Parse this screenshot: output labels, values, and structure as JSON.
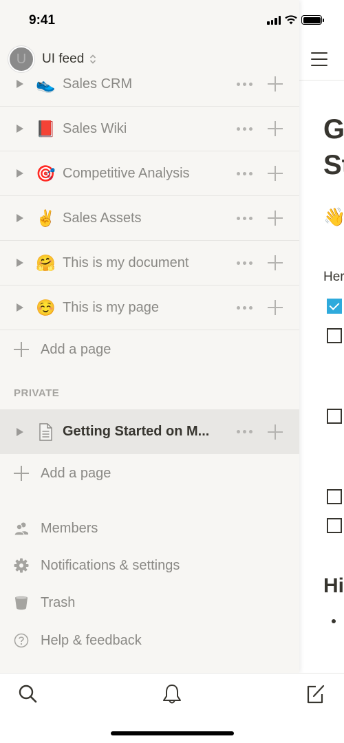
{
  "status_bar": {
    "time": "9:41"
  },
  "workspace": {
    "avatar_letter": "U",
    "name": "UI feed"
  },
  "sidebar": {
    "pages": [
      {
        "emoji": "👟",
        "emoji_name": "sneaker-icon",
        "label": "Sales CRM"
      },
      {
        "emoji": "📕",
        "emoji_name": "red-book-icon",
        "label": "Sales Wiki"
      },
      {
        "emoji": "🎯",
        "emoji_name": "target-icon",
        "label": "Competitive Analysis"
      },
      {
        "emoji": "✌️",
        "emoji_name": "victory-hand-icon",
        "label": "Sales Assets"
      },
      {
        "emoji": "🤗",
        "emoji_name": "hugging-face-icon",
        "label": "This is my document"
      },
      {
        "emoji": "☺️",
        "emoji_name": "smiling-face-icon",
        "label": "This is my page"
      }
    ],
    "add_page_label": "Add a page",
    "private_section": {
      "title": "PRIVATE",
      "pages": [
        {
          "label": "Getting Started on M...",
          "selected": true
        }
      ],
      "add_page_label": "Add a page"
    },
    "menu": [
      {
        "icon": "members-icon",
        "label": "Members"
      },
      {
        "icon": "gear-icon",
        "label": "Notifications & settings"
      },
      {
        "icon": "trash-icon",
        "label": "Trash"
      },
      {
        "icon": "help-icon",
        "label": "Help & feedback"
      }
    ]
  },
  "main_page": {
    "title": "Getting Started on M",
    "wave_emoji": "👋",
    "intro_text": "Here",
    "checklist": [
      {
        "checked": true
      },
      {
        "checked": false
      },
      {
        "checked": false
      },
      {
        "checked": false
      },
      {
        "checked": false
      }
    ],
    "heading2": "Hi"
  }
}
